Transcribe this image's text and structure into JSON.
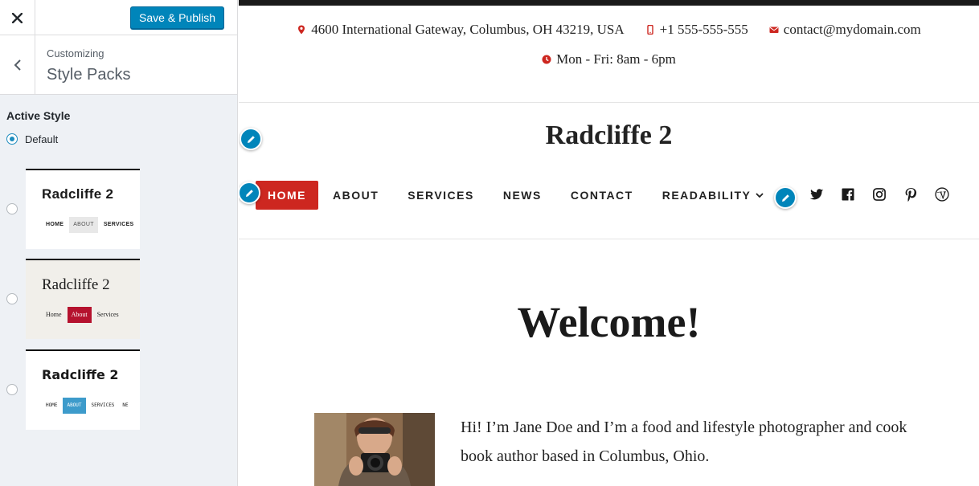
{
  "sidebar": {
    "publish_label": "Save & Publish",
    "customizing_label": "Customizing",
    "section_title": "Style Packs",
    "group_title": "Active Style",
    "default_option": "Default",
    "styles": [
      {
        "title": "Radcliffe 2",
        "nav": [
          "HOME",
          "ABOUT",
          "SERVICES"
        ],
        "active": "ABOUT"
      },
      {
        "title": "Radcliffe 2",
        "nav": [
          "Home",
          "About",
          "Services"
        ],
        "active": "About"
      },
      {
        "title": "Radcliffe 2",
        "nav": [
          "HOME",
          "ABOUT",
          "SERVICES",
          "NE"
        ],
        "active": "ABOUT"
      }
    ]
  },
  "preview": {
    "address": "4600 International Gateway, Columbus, OH 43219, USA",
    "phone": "+1 555-555-555",
    "email": "contact@mydomain.com",
    "hours": "Mon - Fri: 8am - 6pm",
    "site_title": "Radcliffe 2",
    "nav": [
      "HOME",
      "ABOUT",
      "SERVICES",
      "NEWS",
      "CONTACT",
      "READABILITY"
    ],
    "socials": [
      "twitter-icon",
      "facebook-icon",
      "instagram-icon",
      "pinterest-icon",
      "wordpress-icon"
    ],
    "welcome": "Welcome!",
    "intro": "Hi! I’m Jane Doe and I’m a food and lifestyle photographer and cook book author based in Columbus, Ohio."
  },
  "colors": {
    "primary_blue": "#0085ba",
    "nav_active": "#cd2720",
    "info_icon": "#cd2720"
  }
}
